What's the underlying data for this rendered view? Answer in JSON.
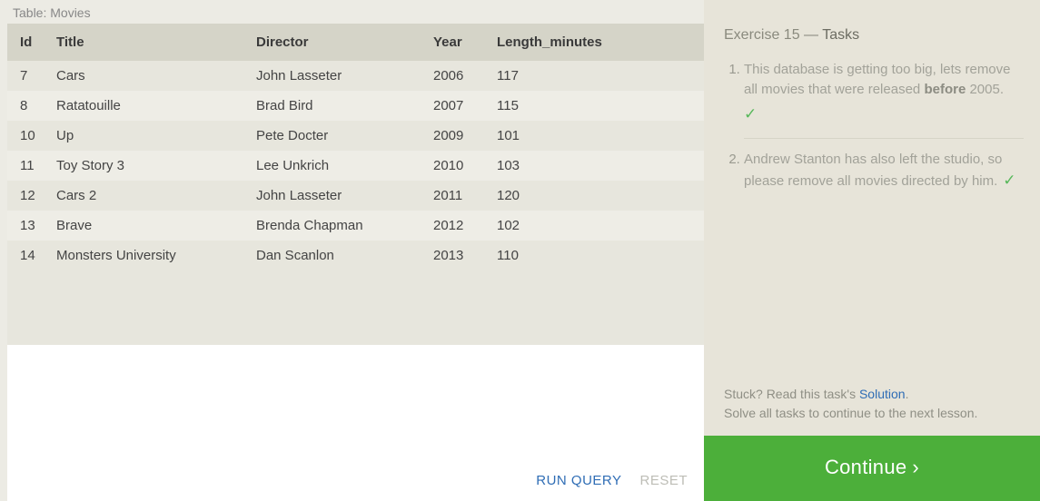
{
  "table": {
    "label": "Table: Movies",
    "columns": [
      "Id",
      "Title",
      "Director",
      "Year",
      "Length_minutes"
    ],
    "rows": [
      {
        "id": "7",
        "title": "Cars",
        "director": "John Lasseter",
        "year": "2006",
        "length": "117"
      },
      {
        "id": "8",
        "title": "Ratatouille",
        "director": "Brad Bird",
        "year": "2007",
        "length": "115"
      },
      {
        "id": "10",
        "title": "Up",
        "director": "Pete Docter",
        "year": "2009",
        "length": "101"
      },
      {
        "id": "11",
        "title": "Toy Story 3",
        "director": "Lee Unkrich",
        "year": "2010",
        "length": "103"
      },
      {
        "id": "12",
        "title": "Cars 2",
        "director": "John Lasseter",
        "year": "2011",
        "length": "120"
      },
      {
        "id": "13",
        "title": "Brave",
        "director": "Brenda Chapman",
        "year": "2012",
        "length": "102"
      },
      {
        "id": "14",
        "title": "Monsters University",
        "director": "Dan Scanlon",
        "year": "2013",
        "length": "110"
      }
    ]
  },
  "editor": {
    "run_label": "RUN QUERY",
    "reset_label": "RESET"
  },
  "tasks": {
    "heading_prefix": "Exercise 15 — ",
    "heading_label": "Tasks",
    "items": [
      {
        "html": "This database is getting too big, lets remove all movies that were released <strong>before</strong> 2005.",
        "check_below": true
      },
      {
        "html": "Andrew Stanton has also left the studio, so please remove all movies directed by him.",
        "check_below": false
      }
    ]
  },
  "hints": {
    "stuck_prefix": "Stuck? Read this task's ",
    "solution_link": "Solution",
    "stuck_suffix": ".",
    "solve_all": "Solve all tasks to continue to the next lesson."
  },
  "continue": {
    "label": "Continue",
    "chevron": "›"
  },
  "icons": {
    "check": "✓"
  }
}
